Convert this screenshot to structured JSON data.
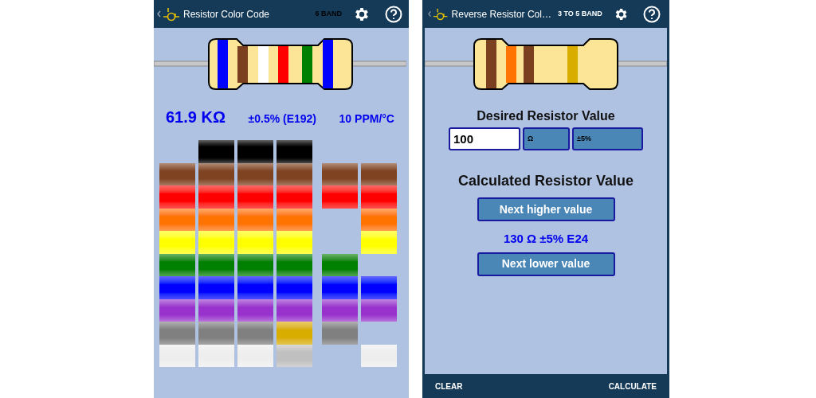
{
  "screens": [
    {
      "kind": "decoder",
      "title": "Resistor Color Code",
      "band_label": "6 BAND",
      "band_label_dimmed": true,
      "resistor": {
        "bands": [
          {
            "color": "#0000ff"
          },
          {
            "color": "#7a4020"
          },
          {
            "color": "#ffffff"
          },
          {
            "color": "#ff0000"
          },
          {
            "color": "#008000"
          },
          {
            "color": "#0000ff"
          }
        ]
      },
      "readout": {
        "value": "61.9 KΩ",
        "tolerance": "±0.5% (E192)",
        "tempco": "10 PPM/°C"
      },
      "picker": {
        "columns": [
          {
            "swatches": [
              {
                "kind": "blank"
              },
              {
                "kind": "swatch",
                "color": "#7f4321"
              },
              {
                "kind": "swatch",
                "color": "#ff0000"
              },
              {
                "kind": "swatch",
                "color": "#ff7300"
              },
              {
                "kind": "swatch",
                "color": "#ffff00"
              },
              {
                "kind": "swatch",
                "color": "#008000"
              },
              {
                "kind": "swatch",
                "color": "#0000ff"
              },
              {
                "kind": "swatch",
                "color": "#9932cc"
              },
              {
                "kind": "swatch",
                "color": "#808080"
              },
              {
                "kind": "swatch",
                "color": "#eeeeee"
              }
            ]
          },
          {
            "swatches": [
              {
                "kind": "swatch",
                "color": "#000000"
              },
              {
                "kind": "swatch",
                "color": "#7f4321"
              },
              {
                "kind": "swatch",
                "color": "#ff0000"
              },
              {
                "kind": "swatch",
                "color": "#ff7300"
              },
              {
                "kind": "swatch",
                "color": "#ffff00"
              },
              {
                "kind": "swatch",
                "color": "#008000"
              },
              {
                "kind": "swatch",
                "color": "#0000ff"
              },
              {
                "kind": "swatch",
                "color": "#9932cc"
              },
              {
                "kind": "swatch",
                "color": "#808080"
              },
              {
                "kind": "swatch",
                "color": "#eeeeee"
              }
            ]
          },
          {
            "swatches": [
              {
                "kind": "swatch",
                "color": "#000000"
              },
              {
                "kind": "swatch",
                "color": "#7f4321"
              },
              {
                "kind": "swatch",
                "color": "#ff0000"
              },
              {
                "kind": "swatch",
                "color": "#ff7300"
              },
              {
                "kind": "swatch",
                "color": "#ffff00"
              },
              {
                "kind": "swatch",
                "color": "#008000"
              },
              {
                "kind": "swatch",
                "color": "#0000ff"
              },
              {
                "kind": "swatch",
                "color": "#9932cc"
              },
              {
                "kind": "swatch",
                "color": "#808080"
              },
              {
                "kind": "swatch",
                "color": "#eeeeee"
              }
            ]
          },
          {
            "swatches": [
              {
                "kind": "swatch",
                "color": "#000000"
              },
              {
                "kind": "swatch",
                "color": "#7f4321"
              },
              {
                "kind": "swatch",
                "color": "#ff0000"
              },
              {
                "kind": "swatch",
                "color": "#ff7300"
              },
              {
                "kind": "swatch",
                "color": "#ffff00"
              },
              {
                "kind": "swatch",
                "color": "#008000"
              },
              {
                "kind": "swatch",
                "color": "#0000ff"
              },
              {
                "kind": "swatch",
                "color": "#9932cc"
              },
              {
                "kind": "swatch",
                "color": "#d9ad00"
              },
              {
                "kind": "swatch",
                "color": "#c0c0c0"
              }
            ]
          },
          {
            "swatches": [
              {
                "kind": "blank"
              },
              {
                "kind": "swatch",
                "color": "#7f4321"
              },
              {
                "kind": "swatch",
                "color": "#ff0000"
              },
              {
                "kind": "blank"
              },
              {
                "kind": "blank"
              },
              {
                "kind": "swatch",
                "color": "#008000"
              },
              {
                "kind": "swatch",
                "color": "#0000ff"
              },
              {
                "kind": "swatch",
                "color": "#9932cc"
              },
              {
                "kind": "swatch",
                "color": "#808080"
              },
              {
                "kind": "blank"
              }
            ]
          },
          {
            "swatches": [
              {
                "kind": "blank"
              },
              {
                "kind": "swatch",
                "color": "#7f4321"
              },
              {
                "kind": "swatch",
                "color": "#ff0000"
              },
              {
                "kind": "swatch",
                "color": "#ff7300"
              },
              {
                "kind": "swatch",
                "color": "#ffff00"
              },
              {
                "kind": "blank"
              },
              {
                "kind": "swatch",
                "color": "#0000ff"
              },
              {
                "kind": "swatch",
                "color": "#9932cc"
              },
              {
                "kind": "blank"
              },
              {
                "kind": "swatch",
                "color": "#eeeeee"
              }
            ]
          }
        ]
      }
    },
    {
      "kind": "reverse",
      "title": "Reverse Resistor Col…",
      "band_label": "3 TO 5 BAND",
      "band_label_dimmed": false,
      "resistor": {
        "bands": [
          {
            "color": "#7a4020"
          },
          {
            "color": "#ff7300"
          },
          {
            "color": "#7a4020"
          },
          {
            "color": "#d9ad00"
          }
        ]
      },
      "desired": {
        "heading": "Desired Resistor Value",
        "value": "100",
        "unit": "Ω",
        "tolerance": "±5%"
      },
      "calculated": {
        "heading": "Calculated Resistor Value",
        "higher_button": "Next higher value",
        "result": "130 Ω ±5% E24",
        "lower_button": "Next lower value"
      },
      "bottom_bar": {
        "left": "CLEAR",
        "right": "CALCULATE"
      }
    }
  ]
}
